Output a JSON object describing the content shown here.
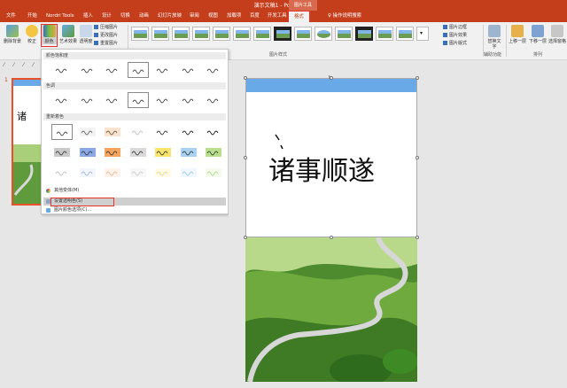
{
  "titlebar": {
    "document": "演示文稿1 - PowerPoint",
    "context_tab": "图片工具"
  },
  "tabs": [
    {
      "label": "文件"
    },
    {
      "label": "开始"
    },
    {
      "label": "Nordri Tools"
    },
    {
      "label": "插入"
    },
    {
      "label": "设计"
    },
    {
      "label": "切换"
    },
    {
      "label": "动画"
    },
    {
      "label": "幻灯片放映"
    },
    {
      "label": "审阅"
    },
    {
      "label": "视图"
    },
    {
      "label": "加载项"
    },
    {
      "label": "百度"
    },
    {
      "label": "开发工具"
    },
    {
      "label": "帮助"
    },
    {
      "label": "格式"
    }
  ],
  "tell_me": "操作说明搜索",
  "ribbon": {
    "remove_bg": "删除背景",
    "corrections": "校正",
    "color": "颜色",
    "artistic": "艺术效果",
    "transparency": "透明度",
    "compress": "压缩图片",
    "change": "更改图片",
    "reset": "重置图片",
    "styles_group": "图片样式",
    "border": "图片边框",
    "effects": "图片效果",
    "layout": "图片版式",
    "alt_text": "替换文字",
    "accessibility_group": "辅助功能",
    "bring_forward": "上移一层",
    "send_backward": "下移一层",
    "selection_pane": "选择窗格",
    "arrange_group": "排列"
  },
  "slide_panel": {
    "number": "1"
  },
  "menu": {
    "saturation_header": "颜色饱和度",
    "tone_header": "色调",
    "recolor_header": "重新着色",
    "recolor_labels": [
      "不重新着色",
      "灰度",
      "褐色",
      "冲蚀",
      "黑白: 25%",
      "黑白: 50%",
      "黑白: 75%"
    ],
    "more_variations": "其他变体(M)",
    "set_transparent": "设置透明色(S)",
    "picture_color_options": "图片颜色选项(C)..."
  },
  "slide": {
    "calligraphy": "诸事顺遂"
  },
  "colors": {
    "accent": "#c43e1c",
    "highlight_box": "#e8302a"
  }
}
